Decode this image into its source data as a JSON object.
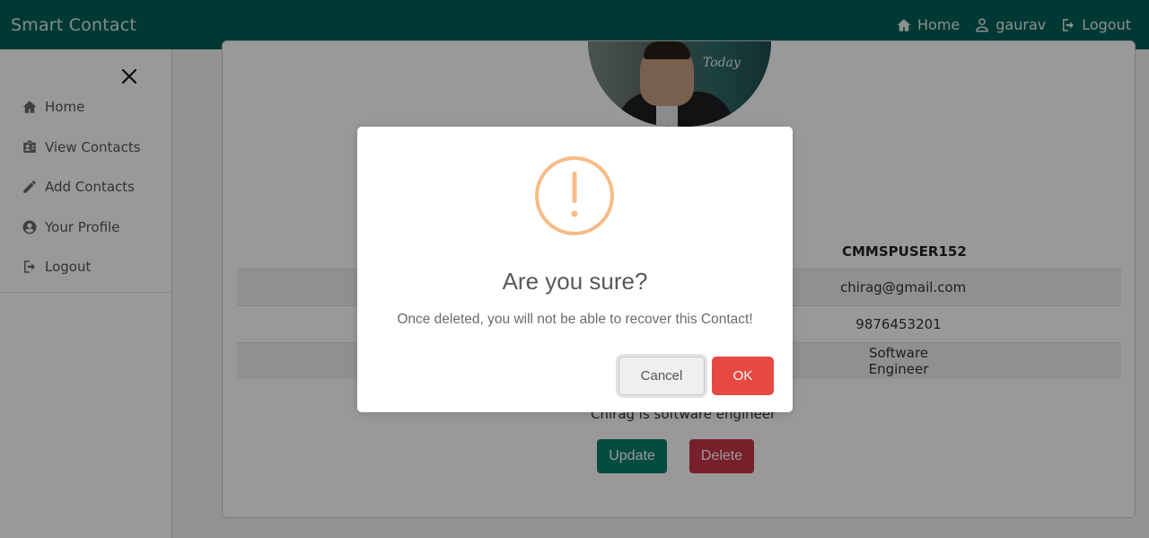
{
  "navbar": {
    "brand": "Smart Contact",
    "links": [
      {
        "label": "Home",
        "icon": "home-icon"
      },
      {
        "label": "gaurav",
        "icon": "user-icon"
      },
      {
        "label": "Logout",
        "icon": "logout-icon"
      }
    ]
  },
  "sidebar": {
    "close_icon": "close-icon",
    "items": [
      {
        "label": "Home",
        "icon": "home-icon"
      },
      {
        "label": "View Contacts",
        "icon": "id-card-icon"
      },
      {
        "label": "Add Contacts",
        "icon": "pencil-icon"
      },
      {
        "label": "Your Profile",
        "icon": "user-circle-icon"
      },
      {
        "label": "Logout",
        "icon": "logout-icon"
      }
    ]
  },
  "contact": {
    "user_id": "CMMSPUSER152",
    "email": "chirag@gmail.com",
    "phone": "9876453201",
    "work": "Software Engineer",
    "description": "Chirag is software engineer",
    "avatar_sign_text": "Today",
    "update_label": "Update",
    "delete_label": "Delete"
  },
  "modal": {
    "title": "Are you sure?",
    "text": "Once deleted, you will not be able to recover this Contact!",
    "cancel_label": "Cancel",
    "ok_label": "OK",
    "icon": "warning-icon",
    "icon_color": "#f8bb86",
    "ok_color": "#e64942"
  },
  "colors": {
    "navbar": "#005f56",
    "update_button": "#0a7d6c",
    "delete_button": "#c9354a"
  }
}
